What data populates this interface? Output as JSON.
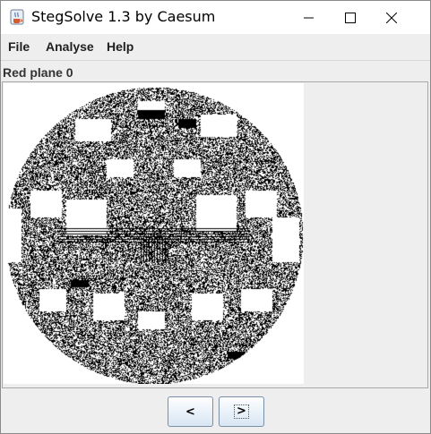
{
  "window": {
    "title": "StegSolve 1.3 by Caesum"
  },
  "menu": {
    "file": "File",
    "analyse": "Analyse",
    "help": "Help"
  },
  "plane_label": "Red plane 0",
  "image": {
    "description_icon": "bitplane-noise-image"
  },
  "nav": {
    "prev_label": "<",
    "next_label": ">"
  },
  "colors": {
    "window_bg": "#eeeeee",
    "button_gradient_top": "#fdfeff",
    "button_gradient_bottom": "#d8e6f3",
    "button_border": "#7a8fa6"
  }
}
